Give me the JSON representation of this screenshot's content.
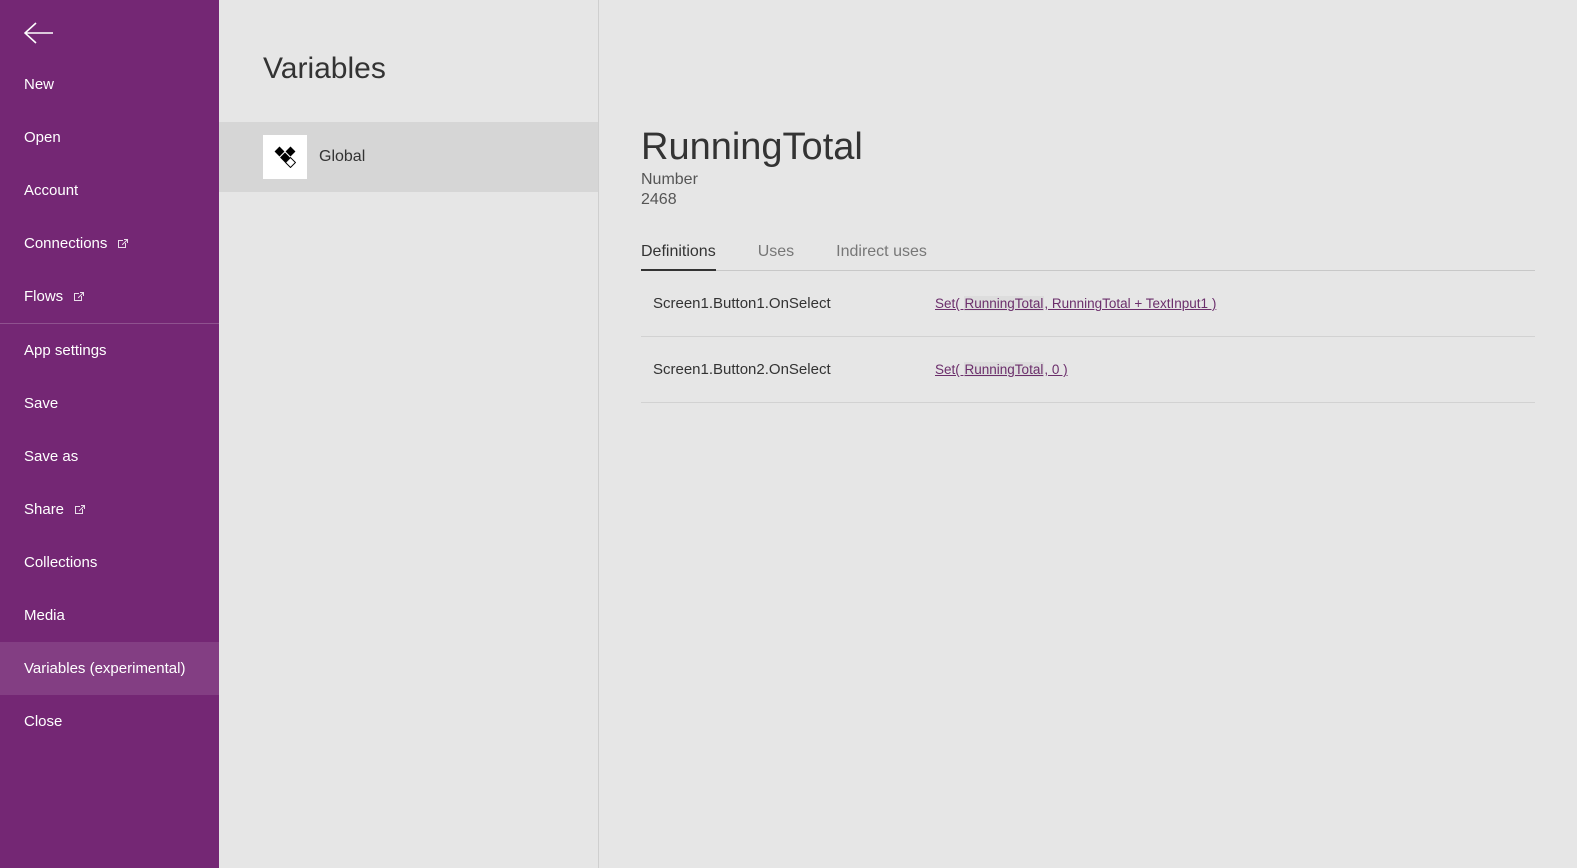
{
  "sidebar": {
    "items": [
      {
        "label": "New",
        "ext": false
      },
      {
        "label": "Open",
        "ext": false
      },
      {
        "label": "Account",
        "ext": false
      },
      {
        "label": "Connections",
        "ext": true
      },
      {
        "label": "Flows",
        "ext": true
      },
      {
        "label": "App settings",
        "ext": false
      },
      {
        "label": "Save",
        "ext": false
      },
      {
        "label": "Save as",
        "ext": false
      },
      {
        "label": "Share",
        "ext": true
      },
      {
        "label": "Collections",
        "ext": false
      },
      {
        "label": "Media",
        "ext": false
      },
      {
        "label": "Variables (experimental)",
        "ext": false
      },
      {
        "label": "Close",
        "ext": false
      }
    ],
    "selected_index": 11,
    "divider_before_index": 5
  },
  "secondary": {
    "title": "Variables",
    "scope": "Global"
  },
  "variable": {
    "name": "RunningTotal",
    "type": "Number",
    "value": "2468"
  },
  "tabs": {
    "definitions": "Definitions",
    "uses": "Uses",
    "indirect": "Indirect uses",
    "active": "definitions"
  },
  "definitions": [
    {
      "source": "Screen1.Button1.OnSelect",
      "formula_prefix": "Set( ",
      "formula_hl": "RunningTotal",
      "formula_suffix": ", RunningTotal + TextInput1 )"
    },
    {
      "source": "Screen1.Button2.OnSelect",
      "formula_prefix": "Set( ",
      "formula_hl": "RunningTotal",
      "formula_suffix": ", 0 )"
    }
  ]
}
